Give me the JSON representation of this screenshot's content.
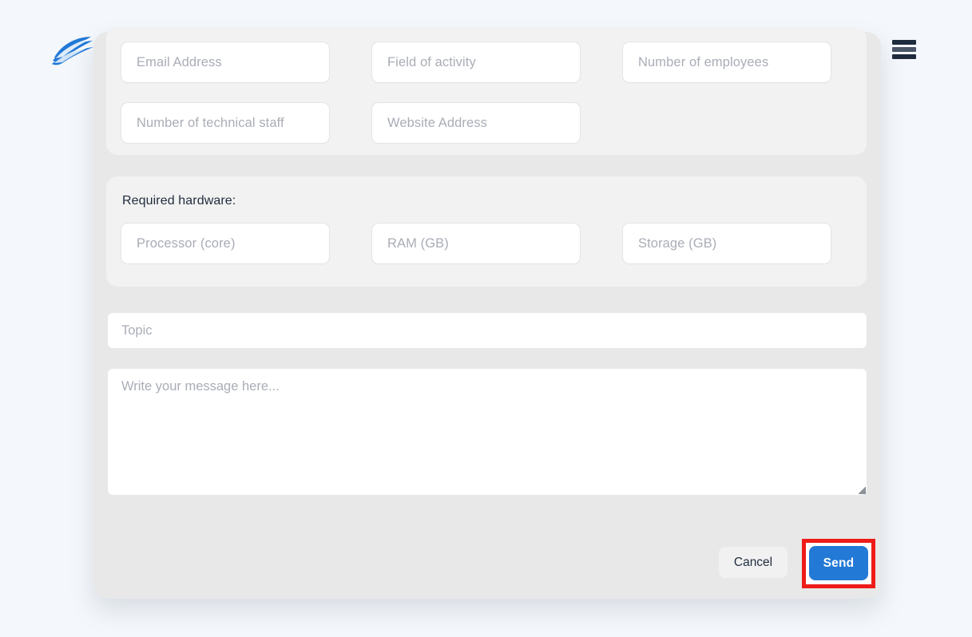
{
  "page": {
    "background_color": "#f4f7fb"
  },
  "header": {
    "logo_name": "company-wave-logo",
    "logo_color": "#2379d6",
    "menu_icon_name": "hamburger-menu-icon",
    "menu_icon_color": "#1f2b3e"
  },
  "modal": {
    "background_color": "#e7e8e7",
    "panel_color": "#f1f2f1",
    "company_info": {
      "fields": [
        {
          "name": "email-address-input",
          "placeholder": "Email Address"
        },
        {
          "name": "field-of-activity-input",
          "placeholder": "Field of activity"
        },
        {
          "name": "number-of-employees-input",
          "placeholder": "Number of employees"
        },
        {
          "name": "number-of-technical-staff-input",
          "placeholder": "Number of technical staff"
        },
        {
          "name": "website-address-input",
          "placeholder": "Website Address"
        }
      ]
    },
    "required_hardware": {
      "label": "Required hardware:",
      "fields": [
        {
          "name": "processor-core-input",
          "placeholder": "Processor (core)"
        },
        {
          "name": "ram-gb-input",
          "placeholder": "RAM (GB)"
        },
        {
          "name": "storage-gb-input",
          "placeholder": "Storage (GB)"
        }
      ]
    },
    "topic": {
      "placeholder": "Topic",
      "value": ""
    },
    "message": {
      "placeholder": "Write your message here...",
      "value": ""
    },
    "footer": {
      "cancel_label": "Cancel",
      "send_label": "Send",
      "send_button_color": "#2379d6",
      "cancel_button_color": "#f1f1f1"
    }
  },
  "annotation": {
    "highlight_target": "send-button",
    "highlight_color": "#ee1c18"
  }
}
